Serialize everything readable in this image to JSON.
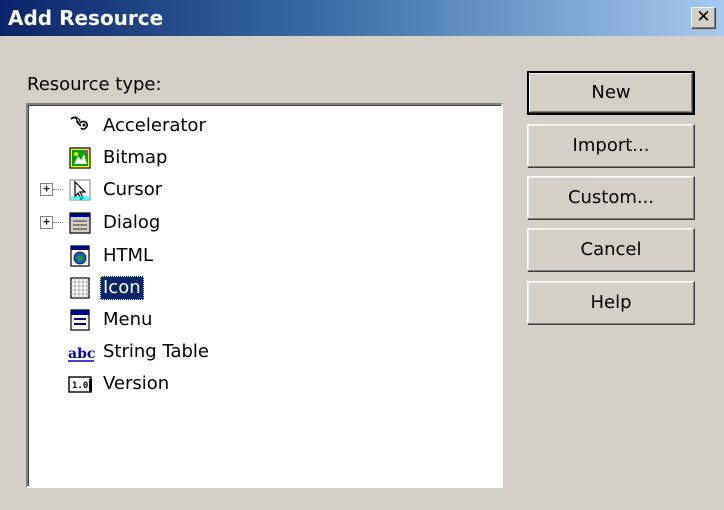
{
  "window": {
    "title": "Add Resource",
    "close_glyph": "✕"
  },
  "resource_type_label": "Resource type:",
  "tree": {
    "items": [
      {
        "label": "Accelerator",
        "icon": "accelerator-icon",
        "expandable": false,
        "selected": false
      },
      {
        "label": "Bitmap",
        "icon": "bitmap-icon",
        "expandable": false,
        "selected": false
      },
      {
        "label": "Cursor",
        "icon": "cursor-icon",
        "expandable": true,
        "selected": false
      },
      {
        "label": "Dialog",
        "icon": "dialog-icon",
        "expandable": true,
        "selected": false
      },
      {
        "label": "HTML",
        "icon": "html-icon",
        "expandable": false,
        "selected": false
      },
      {
        "label": "Icon",
        "icon": "icon-resource-icon",
        "expandable": false,
        "selected": true
      },
      {
        "label": "Menu",
        "icon": "menu-icon",
        "expandable": false,
        "selected": false
      },
      {
        "label": "String Table",
        "icon": "string-table-icon",
        "expandable": false,
        "selected": false
      },
      {
        "label": "Version",
        "icon": "version-icon",
        "expandable": false,
        "selected": false
      }
    ],
    "expander_glyph": "+"
  },
  "buttons": {
    "new": "New",
    "import": "Import...",
    "custom": "Custom...",
    "cancel": "Cancel",
    "help": "Help"
  },
  "colors": {
    "titlebar_start": "#0a246a",
    "titlebar_end": "#a6caf0",
    "dialog_face": "#d4d0c8",
    "selection": "#0a246a"
  }
}
